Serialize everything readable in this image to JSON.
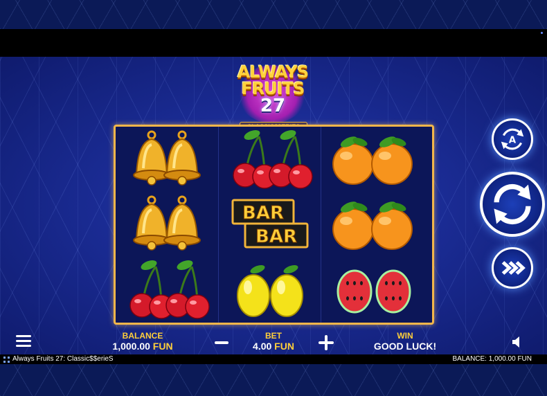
{
  "game": {
    "logo_line1": "ALWAYS",
    "logo_line2": "FRUITS",
    "logo_number": "27",
    "logo_series": "CLASSIC$$ERIES"
  },
  "reels": [
    [
      "bell",
      "bell",
      "cherry"
    ],
    [
      "cherry",
      "bar",
      "lemon"
    ],
    [
      "orange",
      "orange",
      "watermelon"
    ]
  ],
  "symbols": {
    "bar_text_top": "BAR",
    "bar_text_bottom": "BAR"
  },
  "controls": {
    "autoplay_icon": "autoplay-A-icon",
    "spin_icon": "spin-arrows-icon",
    "turbo_icon": "fast-forward-icon",
    "menu_icon": "hamburger-menu-icon",
    "sound_icon": "speaker-icon",
    "bet_decrease_icon": "minus-icon",
    "bet_increase_icon": "plus-icon"
  },
  "hud": {
    "balance_label": "BALANCE",
    "balance_amount": "1,000.00",
    "balance_currency": "FUN",
    "bet_label": "BET",
    "bet_amount": "4.00",
    "bet_currency": "FUN",
    "win_label": "WIN",
    "win_text": "GOOD LUCK!"
  },
  "status_bar": {
    "game_title": "Always Fruits 27: Classic$$erieS",
    "balance_text": "BALANCE: 1,000.00 FUN"
  },
  "colors": {
    "accent_gold": "#ffcf3a",
    "background_blue": "#1a2b93",
    "frame_gold": "#f3b64a"
  }
}
